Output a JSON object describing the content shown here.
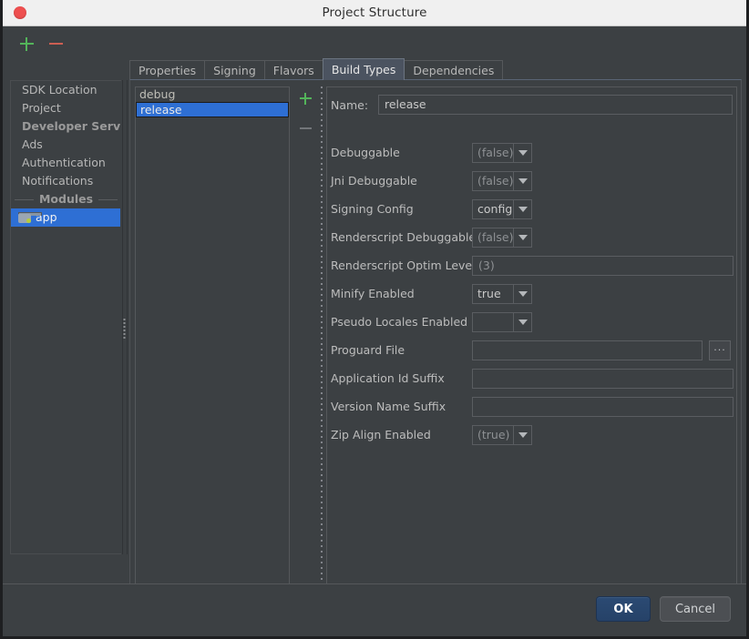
{
  "titlebar": {
    "title": "Project Structure",
    "close_icon": "close-circle-icon"
  },
  "toolbar": {
    "add_label": "+",
    "remove_label": "−"
  },
  "sidebar": {
    "items": [
      {
        "label": "SDK Location",
        "type": "item"
      },
      {
        "label": "Project",
        "type": "item"
      },
      {
        "label": "Developer Servic...",
        "type": "group"
      },
      {
        "label": "Ads",
        "type": "item"
      },
      {
        "label": "Authentication",
        "type": "item"
      },
      {
        "label": "Notifications",
        "type": "item"
      },
      {
        "label": "Modules",
        "type": "separator-group"
      },
      {
        "label": "app",
        "type": "item-selected",
        "icon": "folder-icon"
      }
    ]
  },
  "tabs": [
    {
      "label": "Properties",
      "active": false
    },
    {
      "label": "Signing",
      "active": false
    },
    {
      "label": "Flavors",
      "active": false
    },
    {
      "label": "Build Types",
      "active": true
    },
    {
      "label": "Dependencies",
      "active": false
    }
  ],
  "build_types_list": {
    "items": [
      {
        "label": "debug",
        "selected": false
      },
      {
        "label": "release",
        "selected": true
      }
    ],
    "add_label": "+",
    "remove_label": "−"
  },
  "form": {
    "name_label": "Name:",
    "name_value": "release",
    "fields": [
      {
        "label": "Debuggable",
        "kind": "combo",
        "value": "(false)",
        "placeholder": true
      },
      {
        "label": "Jni Debuggable",
        "kind": "combo",
        "value": "(false)",
        "placeholder": true
      },
      {
        "label": "Signing Config",
        "kind": "combo",
        "value": "config",
        "placeholder": false
      },
      {
        "label": "Renderscript Debuggable",
        "kind": "combo",
        "value": "(false)",
        "placeholder": true
      },
      {
        "label": "Renderscript Optim Level",
        "kind": "text",
        "value": "(3)",
        "placeholder": true
      },
      {
        "label": "Minify Enabled",
        "kind": "combo",
        "value": "true",
        "placeholder": false
      },
      {
        "label": "Pseudo Locales Enabled",
        "kind": "combo",
        "value": "",
        "placeholder": true
      },
      {
        "label": "Proguard File",
        "kind": "text-browse",
        "value": "",
        "placeholder": false,
        "browse_label": "..."
      },
      {
        "label": "Application Id Suffix",
        "kind": "text",
        "value": "",
        "placeholder": false
      },
      {
        "label": "Version Name Suffix",
        "kind": "text",
        "value": "",
        "placeholder": false
      },
      {
        "label": "Zip Align Enabled",
        "kind": "combo",
        "value": "(true)",
        "placeholder": true
      }
    ]
  },
  "footer": {
    "ok_label": "OK",
    "cancel_label": "Cancel"
  },
  "colors": {
    "accent_selection": "#2e6fd4",
    "window_bg": "#3c4043",
    "titlebar_bg": "#f0f0f0",
    "add_green": "#53b45a",
    "remove_red": "#cc5f52",
    "ok_blue": "#2b4a73"
  }
}
